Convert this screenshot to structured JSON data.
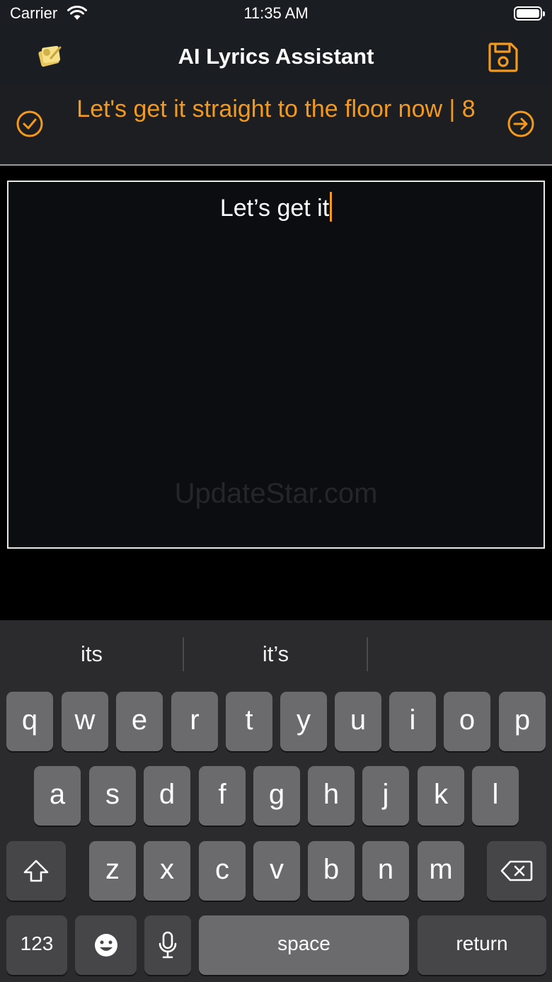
{
  "status_bar": {
    "carrier": "Carrier",
    "time": "11:35 AM"
  },
  "nav": {
    "title": "AI Lyrics Assistant"
  },
  "suggestion": {
    "text": "Let's get it straight to the floor now  |  8"
  },
  "editor": {
    "text": "Let’s get it",
    "watermark": "UpdateStar.com"
  },
  "keyboard": {
    "predictions": [
      "its",
      "it’s",
      ""
    ],
    "row1": [
      "q",
      "w",
      "e",
      "r",
      "t",
      "y",
      "u",
      "i",
      "o",
      "p"
    ],
    "row2": [
      "a",
      "s",
      "d",
      "f",
      "g",
      "h",
      "j",
      "k",
      "l"
    ],
    "row3": [
      "z",
      "x",
      "c",
      "v",
      "b",
      "n",
      "m"
    ],
    "numbers_label": "123",
    "space_label": "space",
    "return_label": "return"
  },
  "colors": {
    "accent": "#f39a1e",
    "bar": "#1a1d22",
    "keyboard": "#2b2b2d"
  },
  "icons": [
    "wifi-icon",
    "battery-icon",
    "app-logo-icon",
    "save-icon",
    "checkmark-circle-icon",
    "arrow-right-circle-icon",
    "shift-icon",
    "delete-icon",
    "emoji-icon",
    "microphone-icon"
  ]
}
